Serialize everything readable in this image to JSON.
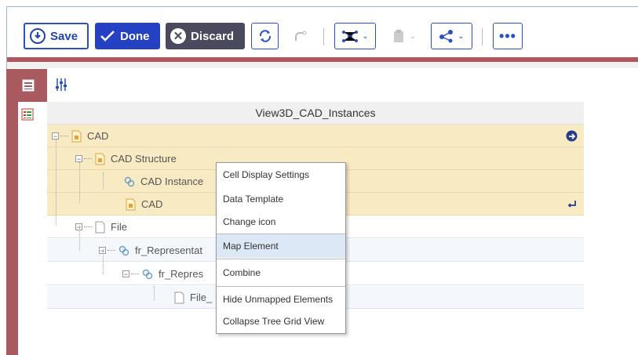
{
  "toolbar": {
    "save_label": "Save",
    "done_label": "Done",
    "discard_label": "Discard",
    "icons": [
      "refresh-icon",
      "redo-icon",
      "network-icon",
      "clipboard-icon",
      "share-icon",
      "more-icon"
    ]
  },
  "grid": {
    "title": "View3D_CAD_Instances",
    "rows": [
      {
        "label": "CAD",
        "icon": "cad-file-icon",
        "level": 0
      },
      {
        "label": "CAD Structure",
        "icon": "cad-file-icon",
        "level": 1
      },
      {
        "label": "CAD Instance",
        "icon": "link-icon",
        "level": 2
      },
      {
        "label": "CAD",
        "icon": "cad-file-icon",
        "level": 2
      },
      {
        "label": "File",
        "icon": "file-icon",
        "level": 1
      },
      {
        "label": "fr_Representat",
        "icon": "link-icon",
        "level": 2
      },
      {
        "label": "fr_Repres",
        "icon": "link-icon",
        "level": 3
      },
      {
        "label": "File_",
        "icon": "file-icon",
        "level": 4
      }
    ]
  },
  "context_menu": {
    "items": [
      "Cell Display Settings",
      "Data Template",
      "Change icon",
      "Map Element",
      "Combine",
      "Hide Unmapped Elements",
      "Collapse Tree Grid View"
    ],
    "highlighted": "Map Element"
  },
  "colors": {
    "accent": "#2441c4",
    "sidebar": "#a85a5f",
    "selected_row": "#f8ebc3"
  }
}
